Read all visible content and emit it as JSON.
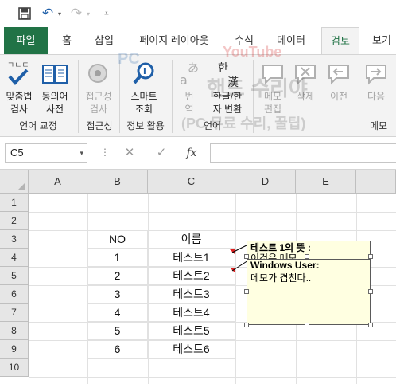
{
  "qat": {
    "save_icon": "save-icon",
    "undo_icon": "undo-icon",
    "redo_icon": "redo-icon",
    "customize_icon": "customize-arrow-icon"
  },
  "tabs": {
    "file": "파일",
    "home": "홈",
    "insert": "삽입",
    "layout": "페이지 레이아웃",
    "formulas": "수식",
    "data": "데이터",
    "review": "검토",
    "view": "보기"
  },
  "ribbon": {
    "spelling": {
      "line1": "맞춤법",
      "line2": "검사",
      "glyph": "ㄱㄴㄷ"
    },
    "thesaurus": {
      "line1": "동의어",
      "line2": "사전"
    },
    "group_proofing": "언어 교정",
    "accessibility": {
      "line1": "접근성",
      "line2": "검사"
    },
    "group_accessibility": "접근성",
    "smart_lookup": {
      "line1": "스마트",
      "line2": "조회"
    },
    "group_insights": "정보 활용",
    "translate": {
      "line1": "번",
      "line2": "역",
      "glyph_top": "あ",
      "glyph_bottom": "a"
    },
    "hangul_hanja": {
      "line1": "한글/한",
      "line2": "자 변환",
      "glyph_top": "한",
      "glyph_bottom": "漢"
    },
    "group_language": "언어",
    "new_comment": {
      "line1": "메모",
      "line2": "편집"
    },
    "delete": {
      "line1": "삭제"
    },
    "previous": {
      "line1": "이전"
    },
    "next": {
      "line1": "다음"
    },
    "group_comments": "메모"
  },
  "watermark": {
    "line1": "PC",
    "line2": "YouTube",
    "line3": "핸드 수리야",
    "line4": "(PC 무료 수리, 꿀팁)"
  },
  "formula_bar": {
    "name_box": "C5",
    "cancel_icon": "✕",
    "enter_icon": "✓",
    "fx": "fx",
    "value": ""
  },
  "columns": [
    "A",
    "B",
    "C",
    "D",
    "E"
  ],
  "rows": [
    "1",
    "2",
    "3",
    "4",
    "5",
    "6",
    "7",
    "8",
    "9",
    "10"
  ],
  "cells": {
    "B3": "NO",
    "C3": "이름",
    "B4": "1",
    "C4": "테스트1",
    "B5": "2",
    "C5": "테스트2",
    "B6": "3",
    "C6": "테스트3",
    "B7": "4",
    "C7": "테스트4",
    "B8": "5",
    "C8": "테스트5",
    "B9": "6",
    "C9": "테스트6"
  },
  "comment": {
    "title1": "테스트 1의 뜻 :",
    "body1": "이것은 메모",
    "author": "Windows User:",
    "body2": "메모가 겹친다.."
  }
}
